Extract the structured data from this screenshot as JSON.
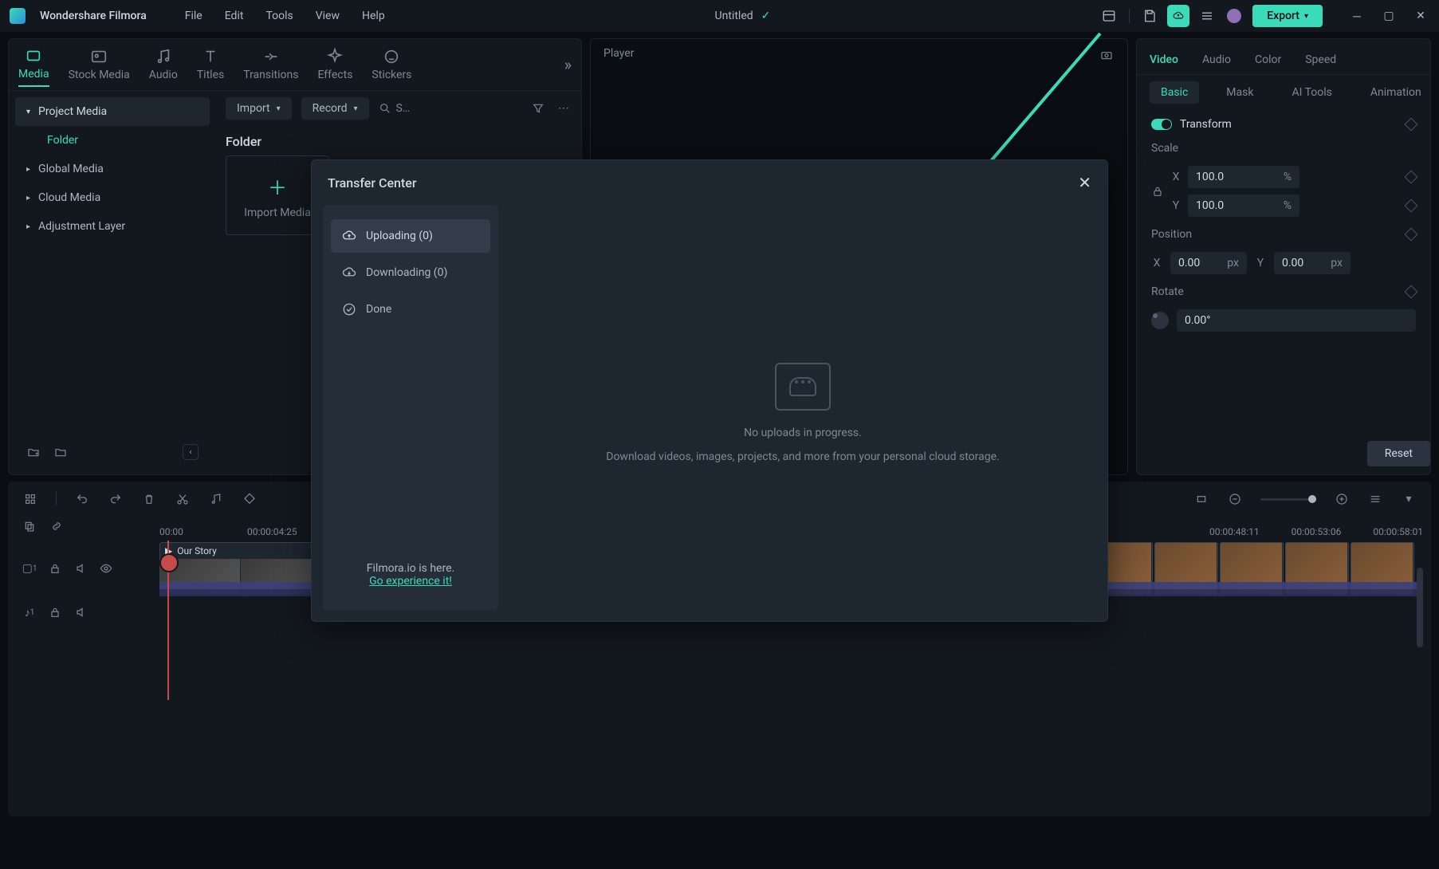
{
  "app": {
    "name": "Wondershare Filmora",
    "menu": [
      "File",
      "Edit",
      "Tools",
      "View",
      "Help"
    ],
    "project_title": "Untitled",
    "export_label": "Export"
  },
  "media_tabs": [
    {
      "label": "Media",
      "active": true
    },
    {
      "label": "Stock Media"
    },
    {
      "label": "Audio"
    },
    {
      "label": "Titles"
    },
    {
      "label": "Transitions"
    },
    {
      "label": "Effects"
    },
    {
      "label": "Stickers"
    }
  ],
  "media_tree": {
    "project_media": "Project Media",
    "folder": "Folder",
    "global_media": "Global Media",
    "cloud_media": "Cloud Media",
    "adjustment_layer": "Adjustment Layer"
  },
  "media_content": {
    "import_label": "Import",
    "record_label": "Record",
    "search_placeholder": "S…",
    "folder_title": "Folder",
    "import_tile": "Import Media"
  },
  "player": {
    "title": "Player"
  },
  "inspector": {
    "tabs": [
      "Video",
      "Audio",
      "Color",
      "Speed"
    ],
    "subtabs": [
      "Basic",
      "Mask",
      "AI Tools",
      "Animation"
    ],
    "transform": "Transform",
    "scale": "Scale",
    "scale_x": "100.0",
    "scale_y": "100.0",
    "pct": "%",
    "position": "Position",
    "pos_x": "0.00",
    "pos_y": "0.00",
    "px": "px",
    "rotate": "Rotate",
    "rotate_val": "0.00°",
    "reset": "Reset"
  },
  "timeline": {
    "ruler": [
      "00:00",
      "00:00:04:25"
    ],
    "ruler_right": [
      "00:00:48:11",
      "00:00:53:06",
      "00:00:58:01"
    ],
    "clip_name": "Our Story",
    "track_video": "1",
    "track_audio": "1"
  },
  "modal": {
    "title": "Transfer Center",
    "uploading": "Uploading (0)",
    "downloading": "Downloading (0)",
    "done": "Done",
    "promo_line": "Filmora.io is here.",
    "promo_link": "Go experience it!",
    "empty_line1": "No uploads in progress.",
    "empty_line2": "Download videos, images, projects, and more from your personal cloud storage."
  }
}
